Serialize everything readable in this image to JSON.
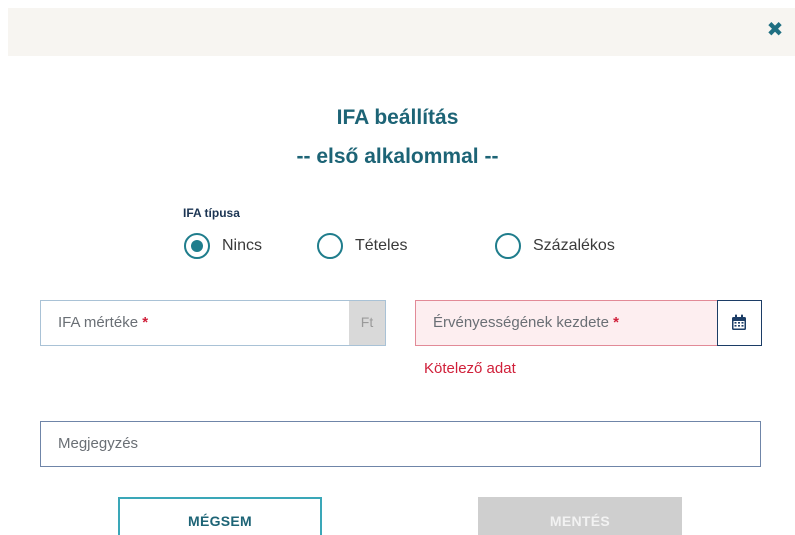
{
  "close": {
    "glyph": "✖"
  },
  "title": {
    "line1": "IFA beállítás",
    "line2": "-- első alkalommal --"
  },
  "vat_type": {
    "label": "IFA típusa",
    "options": [
      {
        "label": "Nincs",
        "checked": true
      },
      {
        "label": "Tételes",
        "checked": false
      },
      {
        "label": "Százalékos",
        "checked": false
      }
    ]
  },
  "fields": {
    "rate": {
      "placeholder": "IFA mértéke",
      "required_mark": "*",
      "suffix": "Ft"
    },
    "valid_from": {
      "placeholder": "Érvényességének kezdete",
      "required_mark": "*",
      "error": "Kötelező adat",
      "icon": "calendar-icon"
    },
    "note": {
      "placeholder": "Megjegyzés"
    }
  },
  "buttons": {
    "cancel": "MÉGSEM",
    "save": "MENTÉS"
  },
  "colors": {
    "accent": "#1d6476",
    "radio": "#1f7d8c",
    "error": "#d0203a",
    "error_bg": "#fdeef0",
    "disabled": "#cfcfcf"
  }
}
